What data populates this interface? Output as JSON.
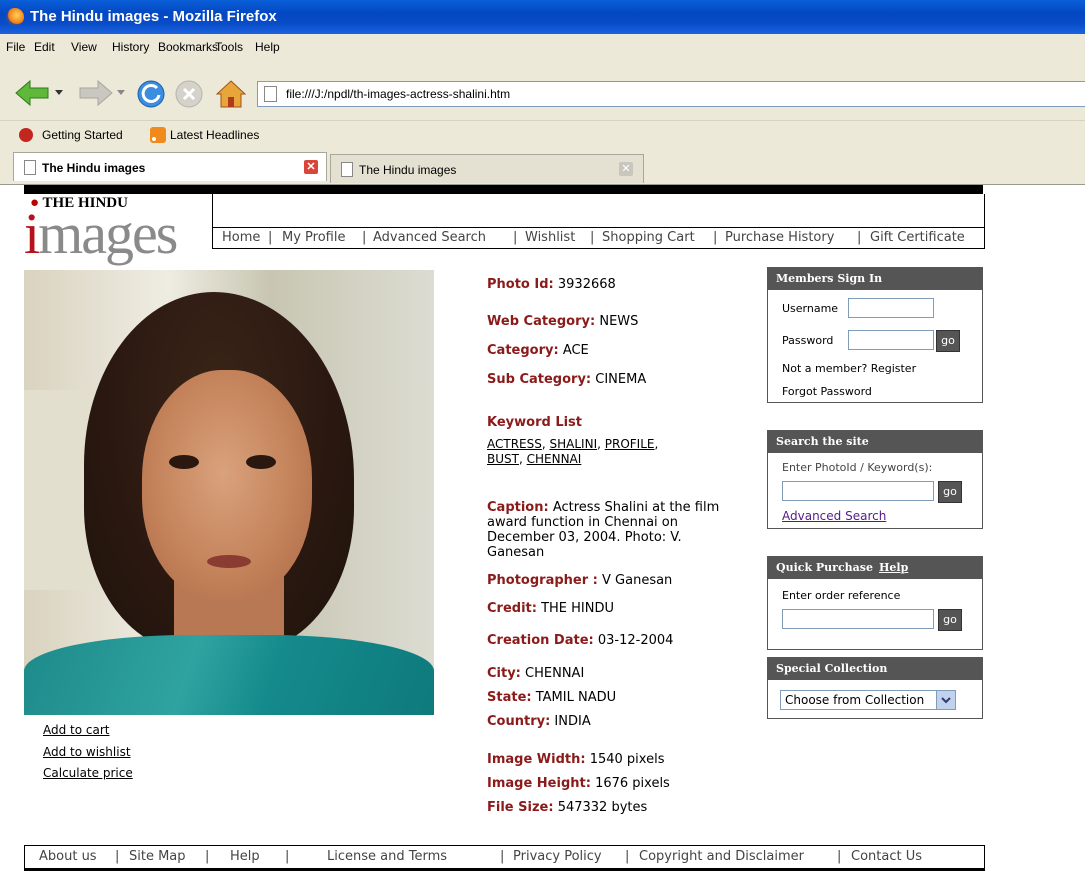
{
  "window": {
    "title": "The Hindu images - Mozilla Firefox"
  },
  "menu": [
    "File",
    "Edit",
    "View",
    "History",
    "Bookmarks",
    "Tools",
    "Help"
  ],
  "address_bar": {
    "url": "file:///J:/npdl/th-images-actress-shalini.htm"
  },
  "bookmarks": [
    "Getting Started",
    "Latest Headlines"
  ],
  "tabs": [
    {
      "label": "The Hindu images",
      "active": true
    },
    {
      "label": "The Hindu images",
      "active": false
    }
  ],
  "logo": {
    "masthead": "THE HINDU",
    "word": "images"
  },
  "topnav": [
    "Home",
    "My Profile",
    "Advanced Search",
    "Wishlist",
    "Shopping Cart",
    "Purchase History",
    "Gift Certificate"
  ],
  "photo_links": [
    "Add to cart",
    "Add to wishlist",
    "Calculate price"
  ],
  "details": {
    "photo_id_label": "Photo Id:",
    "photo_id": "3932668",
    "web_category_label": "Web Category:",
    "web_category": "NEWS",
    "category_label": "Category:",
    "category": "ACE",
    "sub_category_label": "Sub Category:",
    "sub_category": "CINEMA",
    "keyword_list_label": "Keyword List",
    "keywords": [
      "ACTRESS",
      "SHALINI",
      "PROFILE",
      "BUST",
      "CHENNAI"
    ],
    "caption_label": "Caption:",
    "caption": "Actress Shalini at the film award function in Chennai on December 03, 2004. Photo: V. Ganesan",
    "photographer_label": "Photographer :",
    "photographer": "V Ganesan",
    "credit_label": "Credit:",
    "credit": "THE HINDU",
    "creation_date_label": "Creation Date:",
    "creation_date": "03-12-2004",
    "city_label": "City:",
    "city": "CHENNAI",
    "state_label": "State:",
    "state": "TAMIL NADU",
    "country_label": "Country:",
    "country": "INDIA",
    "width_label": "Image Width:",
    "width": "1540 pixels",
    "height_label": "Image Height:",
    "height": "1676 pixels",
    "filesize_label": "File Size:",
    "filesize": "547332 bytes"
  },
  "members": {
    "title": "Members Sign In",
    "username_label": "Username",
    "password_label": "Password",
    "go": "go",
    "register": "Not a member? Register",
    "forgot": "Forgot Password"
  },
  "search": {
    "title": "Search the site",
    "prompt": "Enter PhotoId / Keyword(s):",
    "go": "go",
    "advanced": "Advanced Search"
  },
  "quick": {
    "title": "Quick Purchase",
    "help": "Help",
    "prompt": "Enter order reference",
    "go": "go"
  },
  "special": {
    "title": "Special Collection",
    "select": "Choose from Collection"
  },
  "footer": [
    "About us",
    "Site Map",
    "Help",
    "License and Terms",
    "Privacy Policy",
    "Copyright and Disclaimer",
    "Contact Us"
  ],
  "colors": {
    "label": "#8b1a1a",
    "box_header": "#555555",
    "titlebar": "#0a4cc8"
  }
}
